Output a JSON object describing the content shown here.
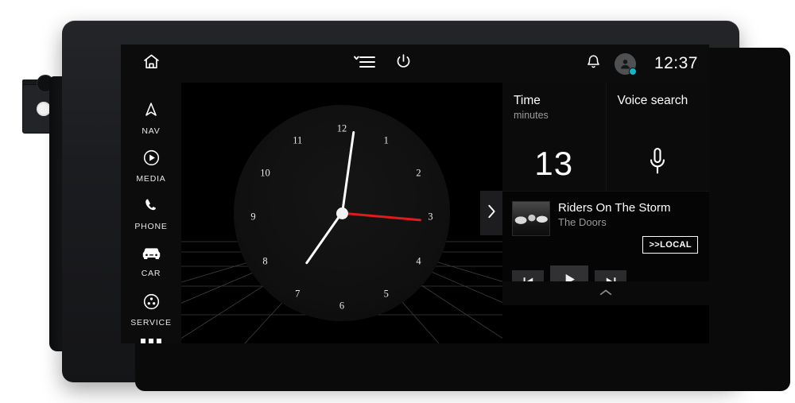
{
  "device": {
    "name": "car-head-unit"
  },
  "topbar": {
    "home_icon": "home-icon",
    "menu_icon": "menu-collapse-icon",
    "power_icon": "power-icon",
    "bell_icon": "notifications-bell-icon",
    "avatar_icon": "user-avatar-icon",
    "status_dot_color": "#12b6c6",
    "time": "12:37"
  },
  "sidebar": {
    "items": [
      {
        "label": "NAV",
        "icon": "navigation-arrow-icon"
      },
      {
        "label": "MEDIA",
        "icon": "media-play-circle-icon"
      },
      {
        "label": "PHONE",
        "icon": "phone-handset-icon"
      },
      {
        "label": "CAR",
        "icon": "car-front-icon"
      },
      {
        "label": "SERVICE",
        "icon": "service-wheel-icon"
      }
    ],
    "more_icon": "more-dots-icon"
  },
  "clock": {
    "numerals": [
      "12",
      "1",
      "2",
      "3",
      "4",
      "5",
      "6",
      "7",
      "8",
      "9",
      "10",
      "11"
    ],
    "hour_angle_deg": 215,
    "minute_angle_deg": 8,
    "second_angle_deg": 95,
    "second_hand_color": "#e01b1b",
    "expand_icon": "chevron-right-icon"
  },
  "widgets": [
    {
      "title": "Time",
      "subtitle": "minutes",
      "value": "13",
      "icon": ""
    },
    {
      "title": "Voice search",
      "subtitle": "",
      "value": "",
      "icon": "microphone-icon"
    }
  ],
  "media": {
    "album_art": "album-art-thumbnail",
    "track_title": "Riders On The Storm",
    "artist": "The Doors",
    "source_badge": ">>LOCAL",
    "controls": [
      {
        "name": "previous-track-button",
        "icon": "skip-previous-icon"
      },
      {
        "name": "play-button",
        "icon": "play-icon"
      },
      {
        "name": "next-track-button",
        "icon": "skip-next-icon"
      }
    ],
    "drawer_icon": "chevron-up-icon"
  }
}
